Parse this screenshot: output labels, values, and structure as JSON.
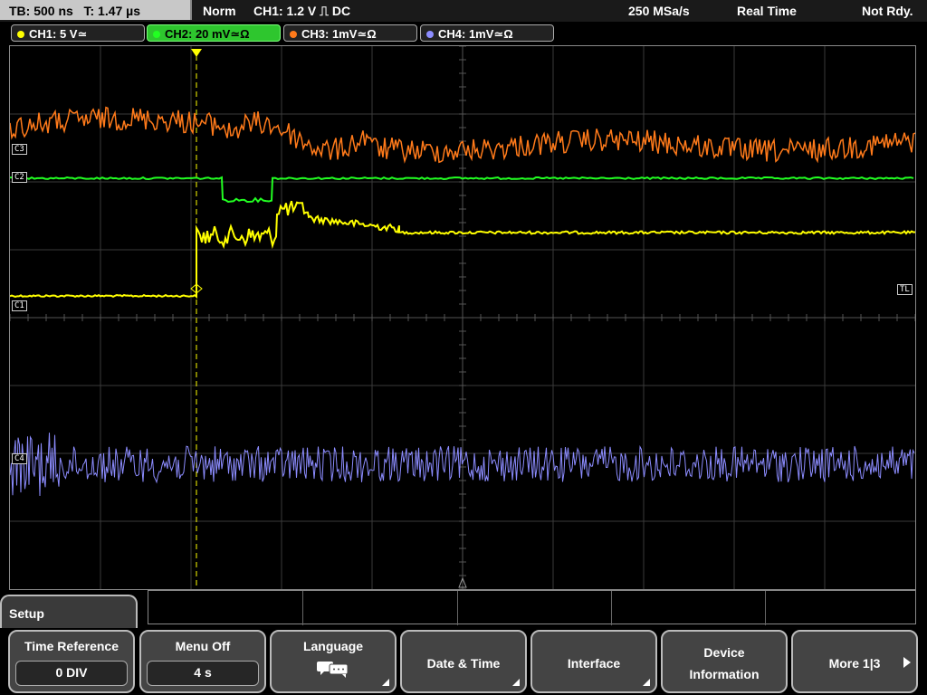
{
  "topbar": {
    "timebase": "TB: 500 ns",
    "trigger_time": "T: 1.47 µs",
    "mode": "Norm",
    "trigger_info": "CH1: 1.2 V ⎍ DC",
    "sample_rate": "250 MSa/s",
    "acquisition": "Real Time",
    "status": "Not Rdy."
  },
  "channels": [
    {
      "label": "CH1: 5 V≃",
      "color": "#ffff00",
      "active": false
    },
    {
      "label": "CH2: 20 mV≃Ω",
      "color": "#22ff22",
      "active": true
    },
    {
      "label": "CH3: 1mV≃Ω",
      "color": "#ff7a1a",
      "active": false
    },
    {
      "label": "CH4: 1mV≃Ω",
      "color": "#8c8cff",
      "active": false
    }
  ],
  "markers": {
    "c3": "C3",
    "c2": "C2",
    "c1": "C1",
    "c4": "C4",
    "trigger_level": "TL",
    "trigger_pos": "T"
  },
  "menu": {
    "title": "Setup",
    "time_reference": {
      "label": "Time Reference",
      "value": "0 DIV"
    },
    "menu_off": {
      "label": "Menu Off",
      "value": "4 s"
    },
    "language": {
      "label": "Language",
      "icon": "speech-bubbles-icon"
    },
    "date_time": {
      "label": "Date & Time"
    },
    "interface": {
      "label": "Interface"
    },
    "device_info": {
      "line1": "Device",
      "line2": "Information"
    },
    "more": {
      "label": "More 1|3"
    }
  }
}
